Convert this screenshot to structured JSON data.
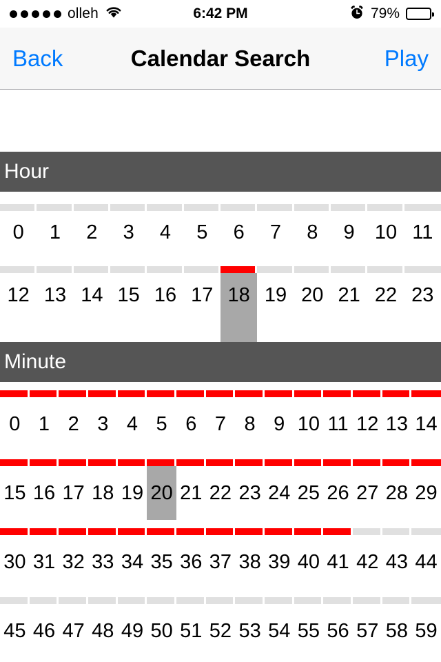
{
  "status_bar": {
    "signal_dots_filled": 5,
    "carrier": "olleh",
    "wifi_icon": "wifi-icon",
    "time": "6:42 PM",
    "alarm_icon": "alarm-clock-icon",
    "battery_percent": "79%",
    "battery_level": 79
  },
  "nav_bar": {
    "back_label": "Back",
    "title": "Calendar Search",
    "play_label": "Play"
  },
  "colors": {
    "accent_blue": "#007aff",
    "active_red": "#ff0000",
    "inactive_gray": "#e0e0e0",
    "selection_gray": "#a8a8a8",
    "header_gray": "#555555",
    "nav_background": "#f7f7f7"
  },
  "sections": [
    {
      "id": "hour",
      "title": "Hour",
      "columns": 12,
      "selected_value": "18",
      "rows": [
        {
          "bar": [
            false,
            false,
            false,
            false,
            false,
            false,
            false,
            false,
            false,
            false,
            false,
            false
          ],
          "values": [
            "0",
            "1",
            "2",
            "3",
            "4",
            "5",
            "6",
            "7",
            "8",
            "9",
            "10",
            "11"
          ]
        },
        {
          "bar": [
            false,
            false,
            false,
            false,
            false,
            false,
            true,
            false,
            false,
            false,
            false,
            false
          ],
          "values": [
            "12",
            "13",
            "14",
            "15",
            "16",
            "17",
            "18",
            "19",
            "20",
            "21",
            "22",
            "23"
          ]
        }
      ]
    },
    {
      "id": "minute",
      "title": "Minute",
      "columns": 15,
      "selected_value": "20",
      "rows": [
        {
          "bar": [
            true,
            true,
            true,
            true,
            true,
            true,
            true,
            true,
            true,
            true,
            true,
            true,
            true,
            true,
            true
          ],
          "values": [
            "0",
            "1",
            "2",
            "3",
            "4",
            "5",
            "6",
            "7",
            "8",
            "9",
            "10",
            "11",
            "12",
            "13",
            "14"
          ]
        },
        {
          "bar": [
            true,
            true,
            true,
            true,
            true,
            true,
            true,
            true,
            true,
            true,
            true,
            true,
            true,
            true,
            true
          ],
          "values": [
            "15",
            "16",
            "17",
            "18",
            "19",
            "20",
            "21",
            "22",
            "23",
            "24",
            "25",
            "26",
            "27",
            "28",
            "29"
          ]
        },
        {
          "bar": [
            true,
            true,
            true,
            true,
            true,
            true,
            true,
            true,
            true,
            true,
            true,
            true,
            false,
            false,
            false
          ],
          "values": [
            "30",
            "31",
            "32",
            "33",
            "34",
            "35",
            "36",
            "37",
            "38",
            "39",
            "40",
            "41",
            "42",
            "43",
            "44"
          ]
        },
        {
          "bar": [
            false,
            false,
            false,
            false,
            false,
            false,
            false,
            false,
            false,
            false,
            false,
            false,
            false,
            false,
            false
          ],
          "values": [
            "45",
            "46",
            "47",
            "48",
            "49",
            "50",
            "51",
            "52",
            "53",
            "54",
            "55",
            "56",
            "57",
            "58",
            "59"
          ]
        }
      ]
    }
  ]
}
